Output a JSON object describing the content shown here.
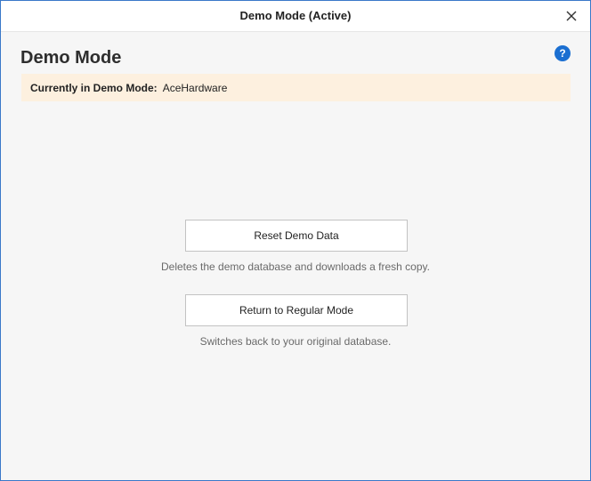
{
  "window": {
    "title": "Demo Mode (Active)"
  },
  "page": {
    "title": "Demo Mode",
    "help_glyph": "?"
  },
  "banner": {
    "label": "Currently in Demo Mode:",
    "value": "AceHardware"
  },
  "actions": {
    "reset": {
      "label": "Reset Demo Data",
      "description": "Deletes the demo database and downloads a fresh copy."
    },
    "return": {
      "label": "Return to Regular Mode",
      "description": "Switches back to your original database."
    }
  },
  "colors": {
    "window_border": "#3a78c9",
    "background": "#f6f6f6",
    "banner_background": "#fdf0df",
    "help_icon": "#1b6fd1"
  },
  "icons": {
    "close": "close-icon",
    "help": "help-icon"
  }
}
